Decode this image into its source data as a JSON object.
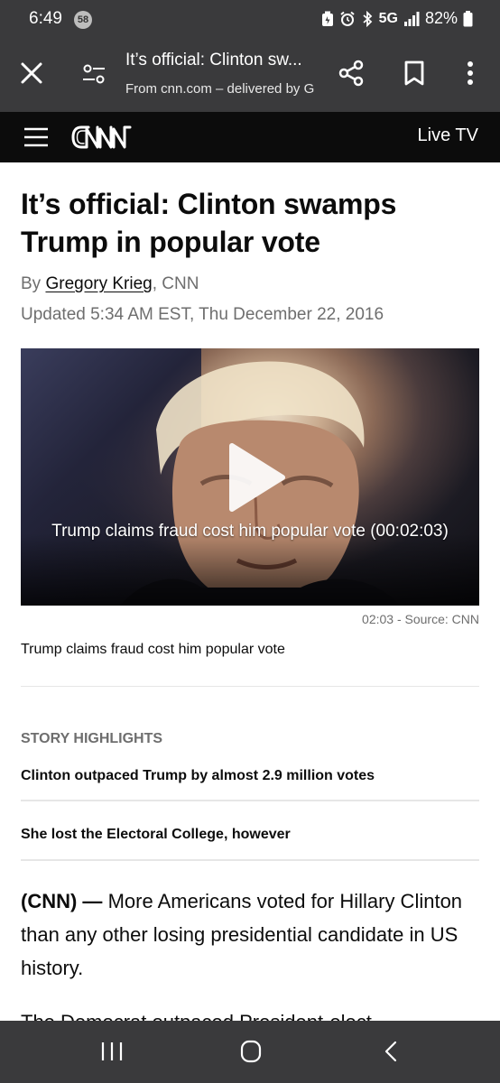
{
  "status_bar": {
    "time": "6:49",
    "notification_count": "58",
    "network": "5G",
    "battery": "82%"
  },
  "toolbar": {
    "page_title": "It’s official: Clinton sw...",
    "source": "From cnn.com – delivered by G"
  },
  "header": {
    "logo_text": "CNN",
    "live_tv_label": "Live TV"
  },
  "article": {
    "headline": "It’s official: Clinton swamps Trump in popular vote",
    "by_prefix": "By",
    "author": "Gregory Krieg",
    "outlet_suffix": ", CNN",
    "updated": "Updated 5:34 AM EST, Thu December 22, 2016",
    "video": {
      "overlay_title": "Trump claims fraud cost him popular vote (00:02:03)",
      "duration_source": "02:03 - Source: CNN",
      "caption": "Trump claims fraud cost him popular vote"
    },
    "highlights": {
      "title": "STORY HIGHLIGHTS",
      "items": [
        "Clinton outpaced Trump by almost 2.9 million votes",
        "She lost the Electoral College, however"
      ]
    },
    "lead_dateline": "(CNN) —",
    "lead_text": "More Americans voted for Hillary Clinton than any other losing presidential candidate in US history.",
    "next_paragraph_start": "The Democrat outpaced President-elect"
  },
  "colors": {
    "chrome": "#3a3a3c",
    "cnn_bar": "#0c0c0c",
    "muted_text": "#6e6e6e"
  },
  "icons": {
    "close": "close-icon",
    "settings": "tune-icon",
    "share": "share-icon",
    "bookmark": "bookmark-icon",
    "more": "more-vert-icon",
    "menu": "hamburger-icon",
    "play": "play-icon",
    "recents": "recents-icon",
    "home": "home-icon",
    "back": "back-icon"
  }
}
